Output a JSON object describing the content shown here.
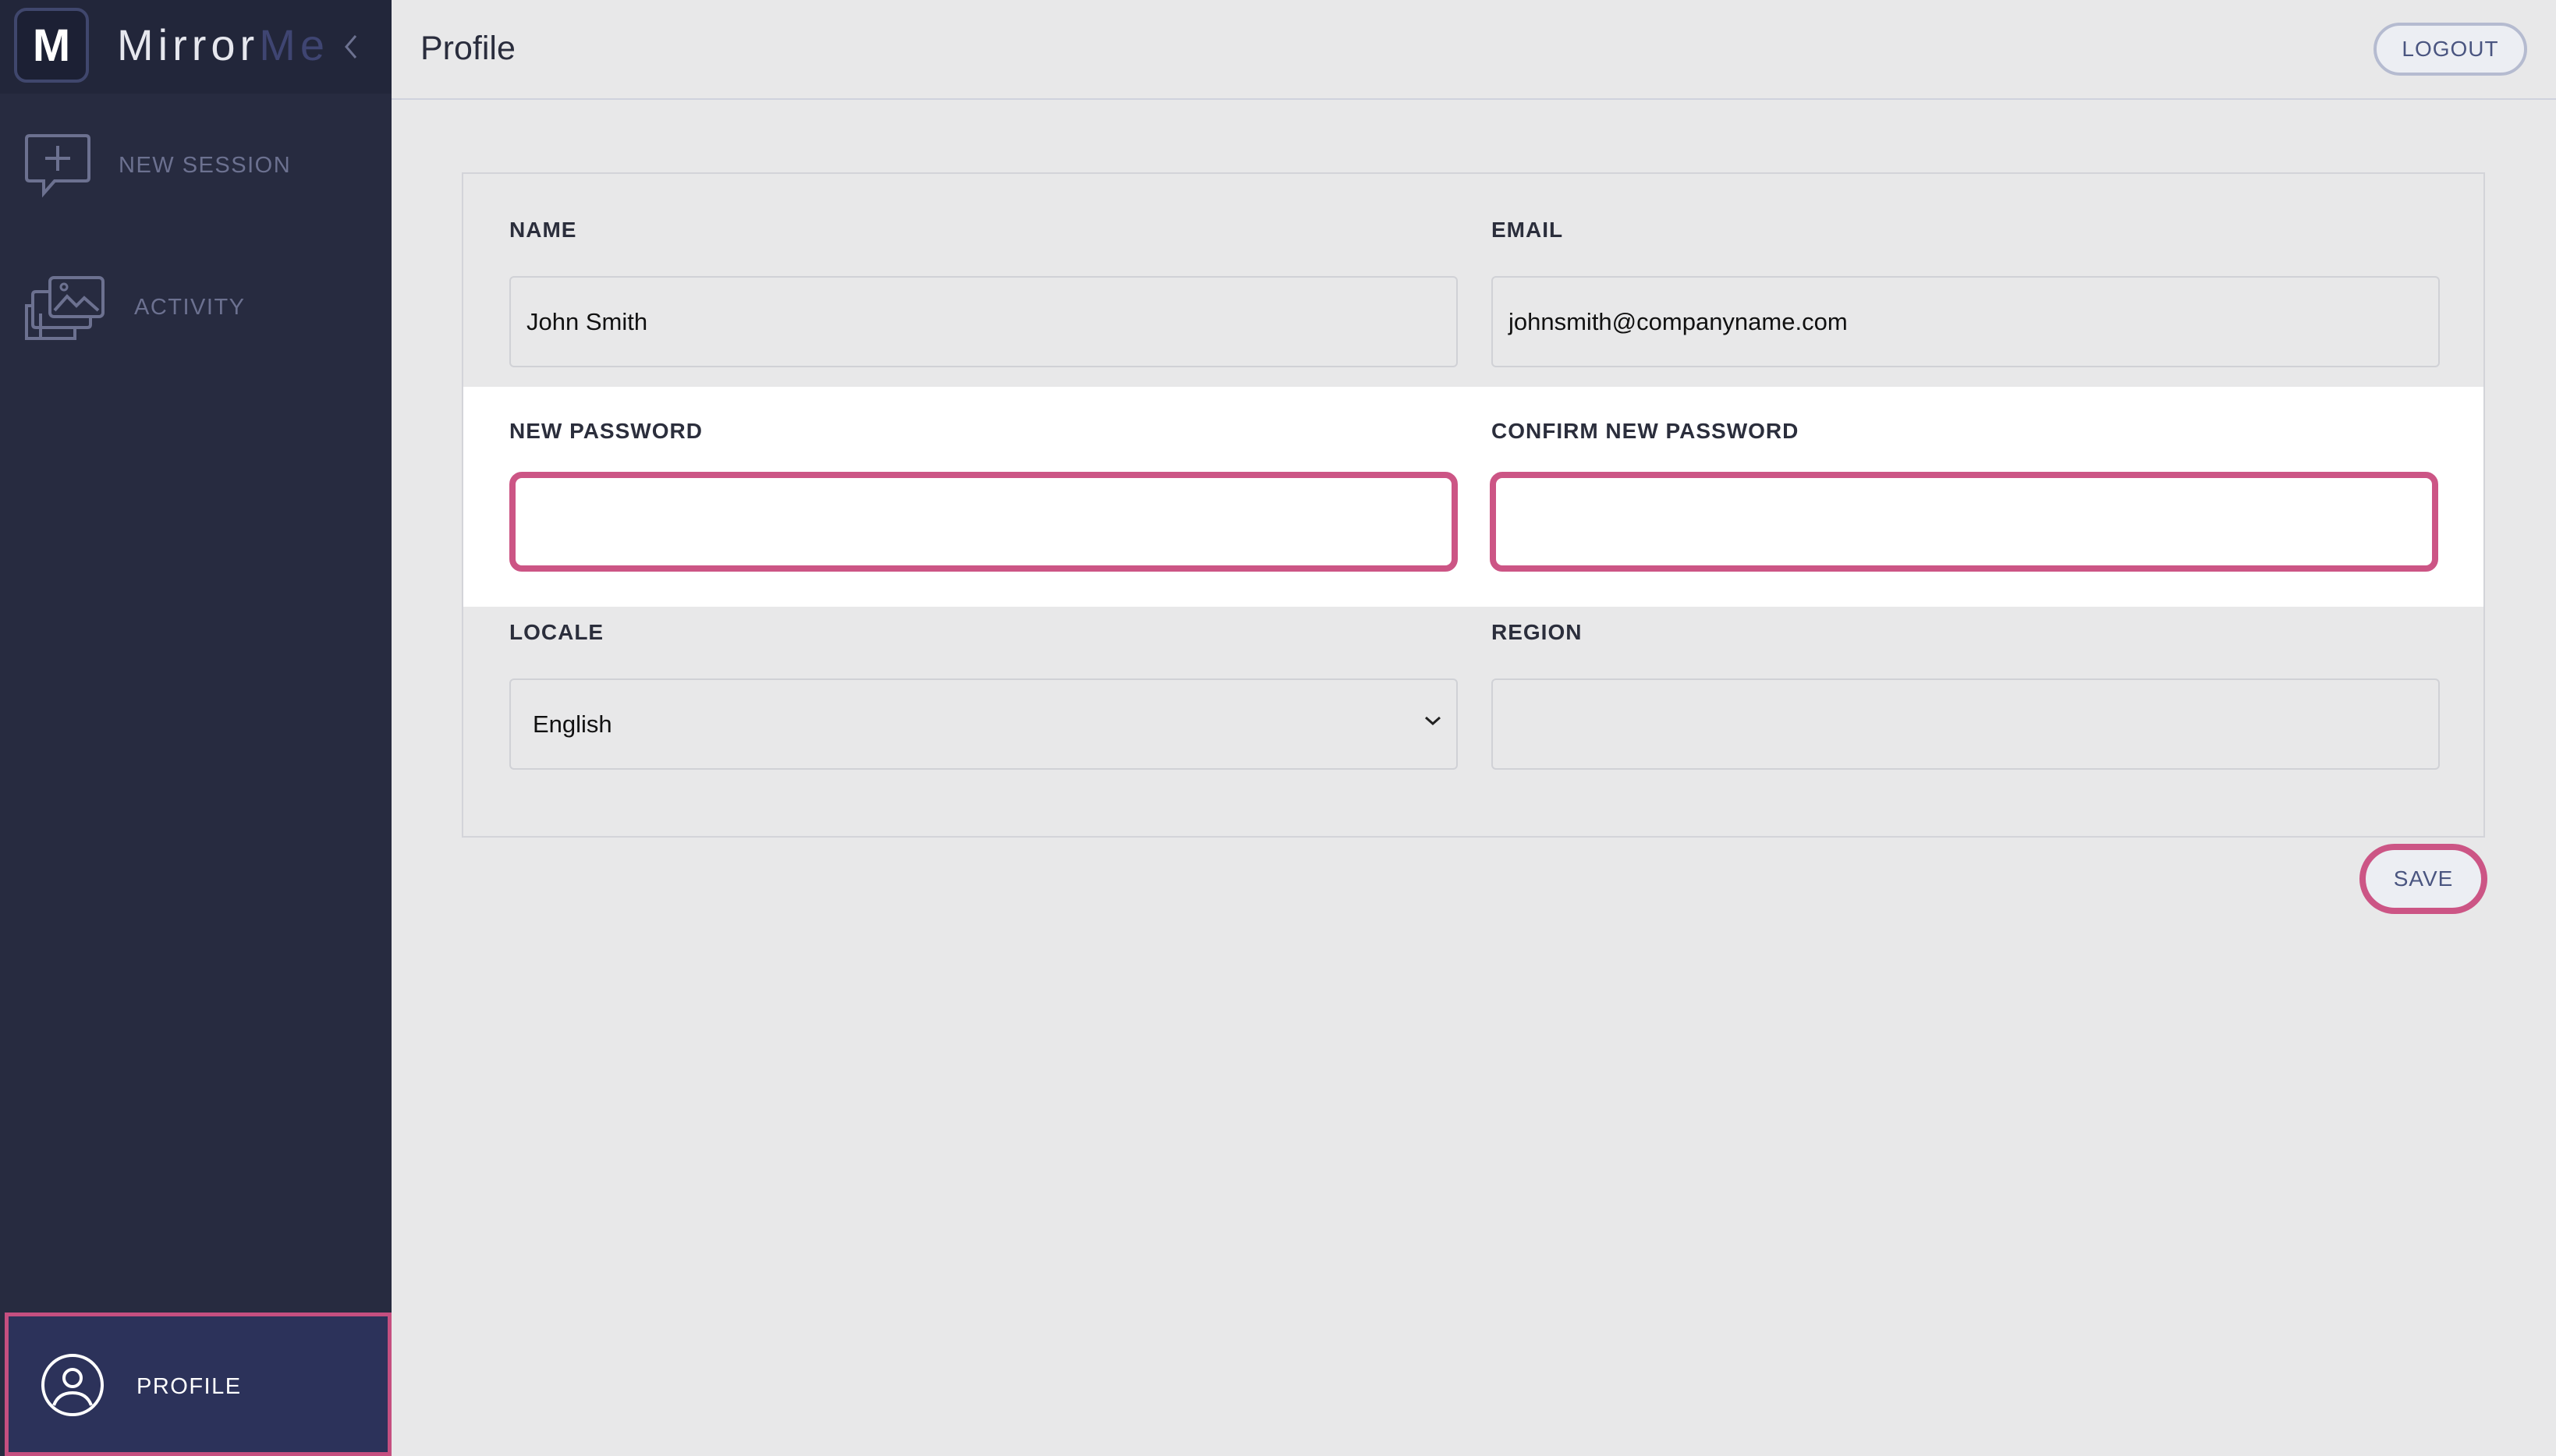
{
  "brand": {
    "logo_letter": "M",
    "name_part1": "Mirror",
    "name_part2": "Me"
  },
  "sidebar": {
    "items": [
      {
        "label": "NEW SESSION",
        "icon": "chat-plus-icon"
      },
      {
        "label": "ACTIVITY",
        "icon": "gallery-icon"
      },
      {
        "label": "PROFILE",
        "icon": "user-circle-icon",
        "active": true
      }
    ]
  },
  "header": {
    "title": "Profile",
    "logout_label": "LOGOUT"
  },
  "form": {
    "name": {
      "label": "NAME",
      "value": "John Smith"
    },
    "email": {
      "label": "EMAIL",
      "value": "johnsmith@companyname.com"
    },
    "new_password": {
      "label": "NEW PASSWORD",
      "value": ""
    },
    "confirm_password": {
      "label": "CONFIRM NEW PASSWORD",
      "value": ""
    },
    "locale": {
      "label": "LOCALE",
      "value": "English"
    },
    "region": {
      "label": "REGION",
      "value": ""
    },
    "save_label": "SAVE"
  },
  "colors": {
    "sidebar_bg": "#272b40",
    "highlight": "#cc5585",
    "accent": "#4a5580"
  }
}
